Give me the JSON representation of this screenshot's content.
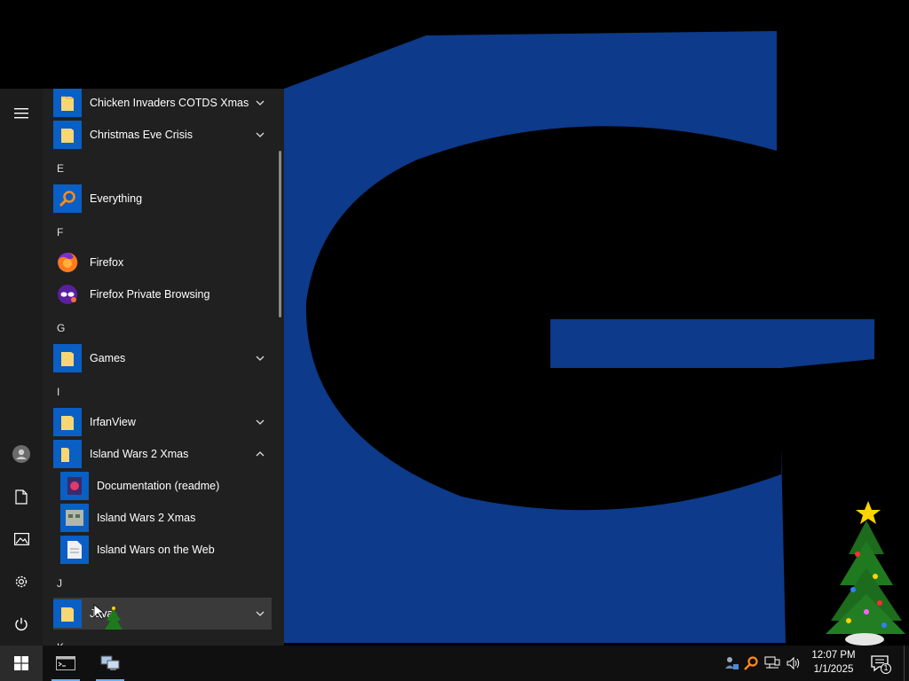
{
  "start_menu": {
    "rail": {
      "expand_icon": "hamburger-icon",
      "account_icon": "user-icon",
      "documents_icon": "document-icon",
      "pictures_icon": "pictures-icon",
      "settings_icon": "gear-icon",
      "power_icon": "power-icon"
    },
    "items": [
      {
        "type": "app",
        "label": "Chicken Invaders COTDS Xmas",
        "icon": "folder-icon",
        "chevron": "down"
      },
      {
        "type": "app",
        "label": "Christmas Eve Crisis",
        "icon": "folder-icon",
        "chevron": "down"
      },
      {
        "type": "letter",
        "label": "E"
      },
      {
        "type": "app",
        "label": "Everything",
        "icon": "magnifier-icon"
      },
      {
        "type": "letter",
        "label": "F"
      },
      {
        "type": "app",
        "label": "Firefox",
        "icon": "firefox-icon"
      },
      {
        "type": "app",
        "label": "Firefox Private Browsing",
        "icon": "firefox-private-icon"
      },
      {
        "type": "letter",
        "label": "G"
      },
      {
        "type": "app",
        "label": "Games",
        "icon": "folder-icon",
        "chevron": "down"
      },
      {
        "type": "letter",
        "label": "I"
      },
      {
        "type": "app",
        "label": "IrfanView",
        "icon": "folder-icon",
        "chevron": "down"
      },
      {
        "type": "app",
        "label": "Island Wars 2 Xmas",
        "icon": "folder-icon",
        "chevron": "up"
      },
      {
        "type": "subapp",
        "label": "Documentation (readme)",
        "icon": "readme-icon"
      },
      {
        "type": "subapp",
        "label": "Island Wars 2 Xmas",
        "icon": "game-icon"
      },
      {
        "type": "subapp",
        "label": "Island Wars on the Web",
        "icon": "web-document-icon"
      },
      {
        "type": "letter",
        "label": "J"
      },
      {
        "type": "app",
        "label": "Java",
        "icon": "folder-icon",
        "chevron": "down"
      },
      {
        "type": "letter",
        "label": "K"
      }
    ]
  },
  "taskbar": {
    "start_icon": "windows-logo-icon",
    "apps": [
      {
        "name": "command-prompt",
        "icon": "console-icon"
      },
      {
        "name": "network-app",
        "icon": "computers-icon"
      }
    ],
    "tray": {
      "icons": [
        "people-network-icon",
        "search-magnifier-icon",
        "network-icon",
        "volume-icon"
      ],
      "time": "12:07 PM",
      "date": "1/1/2025",
      "notification_count": "1"
    }
  },
  "colors": {
    "logo_blue": "#0d3a8a",
    "tile_blue": "#0a5fc4",
    "menu_bg": "#202020",
    "taskbar_bg": "#101010"
  }
}
